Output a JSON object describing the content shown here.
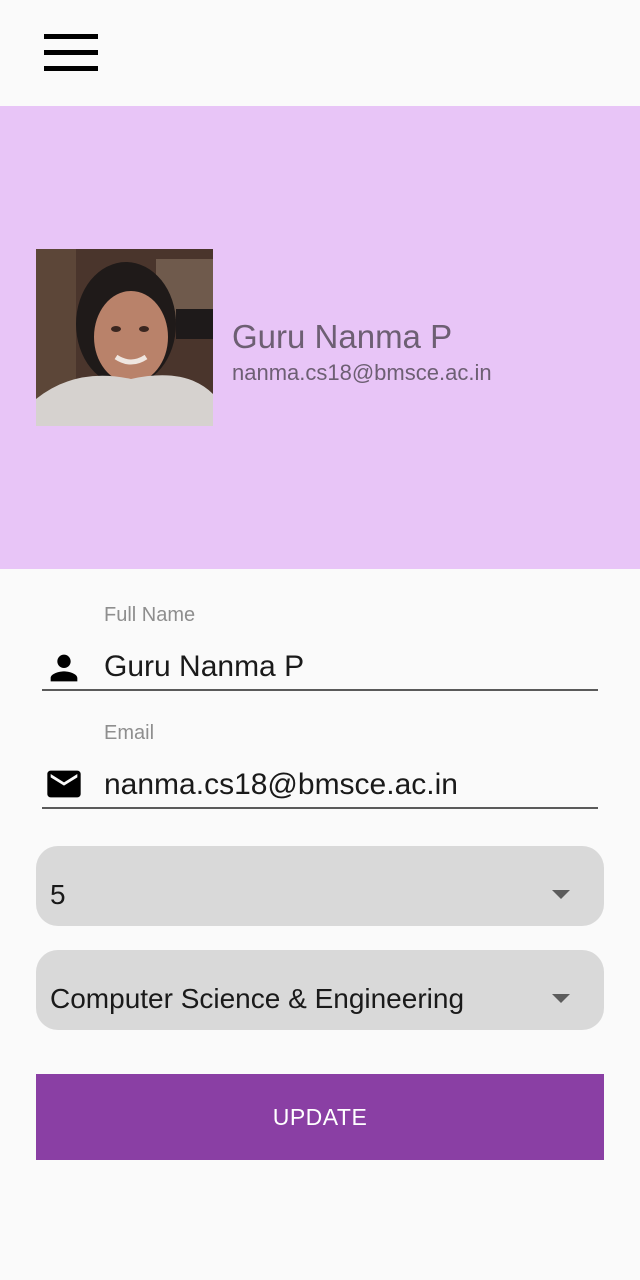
{
  "app": {
    "menu_icon": "hamburger-menu-icon"
  },
  "profile": {
    "name": "Guru Nanma P",
    "email": "nanma.cs18@bmsce.ac.in",
    "avatar": "profile-photo",
    "header_color": "#e8c5f7"
  },
  "form": {
    "full_name": {
      "label": "Full Name",
      "value": "Guru Nanma P",
      "icon": "person-icon"
    },
    "email": {
      "label": "Email",
      "value": "nanma.cs18@bmsce.ac.in",
      "icon": "mail-icon"
    },
    "semester_select": {
      "value": "5"
    },
    "department_select": {
      "value": "Computer Science & Engineering"
    },
    "update_label": "UPDATE",
    "update_color": "#8a3fa4"
  }
}
